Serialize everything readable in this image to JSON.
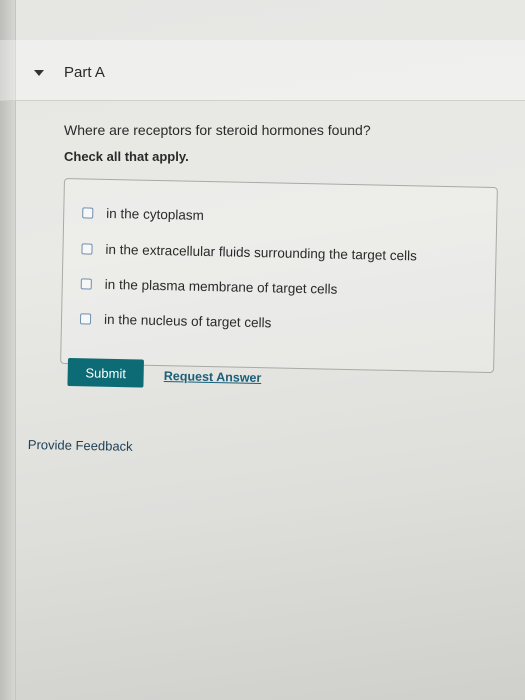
{
  "part": {
    "title": "Part A",
    "icon": "caret-down-icon"
  },
  "question": {
    "text": "Where are receptors for steroid hormones found?",
    "instruction": "Check all that apply."
  },
  "options": [
    {
      "label": "in the cytoplasm",
      "checked": false
    },
    {
      "label": "in the extracellular fluids surrounding the target cells",
      "checked": false
    },
    {
      "label": "in the plasma membrane of target cells",
      "checked": false
    },
    {
      "label": "in the nucleus of target cells",
      "checked": false
    }
  ],
  "actions": {
    "submit_label": "Submit",
    "request_answer_label": "Request Answer"
  },
  "feedback": {
    "label": "Provide Feedback"
  },
  "colors": {
    "submit_bg": "#0c6b74",
    "link": "#1b5f78",
    "checkbox_border": "#6f8fb0"
  }
}
